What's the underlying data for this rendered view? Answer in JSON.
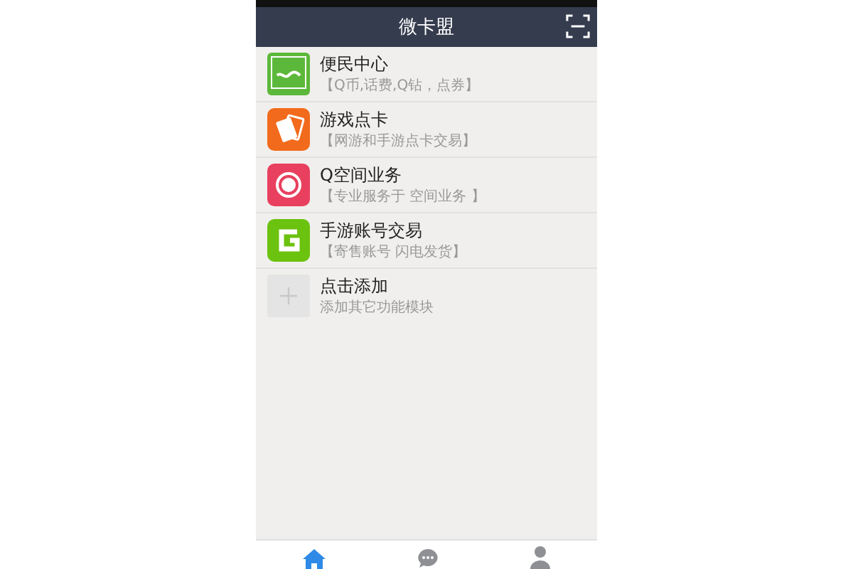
{
  "header": {
    "title": "微卡盟"
  },
  "items": [
    {
      "kind": "app",
      "title": "便民中心",
      "subtitle": "【Q币,话费,Q钻，点券】"
    },
    {
      "kind": "app",
      "title": "游戏点卡",
      "subtitle": "【网游和手游点卡交易】"
    },
    {
      "kind": "app",
      "title": "Q空间业务",
      "subtitle": "【专业服务于 空间业务 】"
    },
    {
      "kind": "app",
      "title": "手游账号交易",
      "subtitle": "【寄售账号 闪电发货】"
    },
    {
      "kind": "add",
      "title": "点击添加",
      "subtitle": "添加其它功能模块"
    }
  ],
  "tabs": [
    {
      "selected": true
    },
    {
      "selected": false
    },
    {
      "selected": false
    }
  ]
}
